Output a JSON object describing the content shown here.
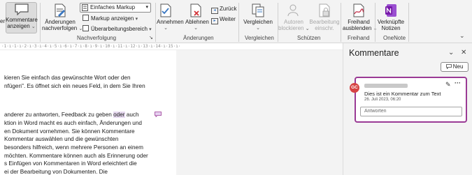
{
  "ribbon": {
    "cut_label_fragment": "er",
    "kommentare_anzeigen": {
      "line1": "Kommentare",
      "line2": "anzeigen"
    },
    "nachverfolgen": {
      "line1": "Änderungen",
      "line2": "nachverfolgen"
    },
    "markup_dropdown": "Einfaches Markup",
    "markup_anzeigen": "Markup anzeigen",
    "ueberarbeitungsbereich": "Überarbeitungsbereich",
    "group_nachverfolgung": "Nachverfolgung",
    "annehmen": "Annehmen",
    "ablehnen": "Ablehnen",
    "zurueck": "Zurück",
    "weiter": "Weiter",
    "group_aenderungen": "Änderungen",
    "vergleichen": "Vergleichen",
    "group_vergleichen": "Vergleichen",
    "autoren_blockieren": {
      "line1": "Autoren",
      "line2": "blockieren"
    },
    "bearbeitung_einschr": {
      "line1": "Bearbeitung",
      "line2": "einschr."
    },
    "group_schuetzen": "Schützen",
    "freihand_ausblenden": {
      "line1": "Freihand",
      "line2": "ausblenden"
    },
    "group_freihand": "Freihand",
    "verknuepfte_notizen": {
      "line1": "Verknüpfte",
      "line2": "Notizen"
    },
    "group_onenote": "OneNote",
    "chevron": "⌄",
    "launcher": "↘"
  },
  "ruler": {
    "text": "·1·ı·1·ı·2·ı·3·ı·4·ı·5·ı·6·ı·7·ı·8·ı·9·ı·10·ı·11·ı·12·ı·13·ı·14·ı·15·ı·"
  },
  "document": {
    "lines": [
      "kieren Sie einfach das gewünschte Wort oder den",
      "nfügen\". Es öffnet sich ein neues Feld, in dem Sie Ihren",
      "anderer zu antworten, Feedback zu geben ",
      "ktion in Word macht es auch einfach, Änderungen und",
      "en Dokument vornehmen. Sie können Kommentare",
      "Kommentar auswählen und die gewünschten",
      "besonders hilfreich, wenn mehrere Personen an einem",
      "möchten. Kommentare können auch als Erinnerung oder",
      "s Einfügen von Kommentaren in Word erleichtert die",
      "ei der Bearbeitung von Dokumenten. Die"
    ],
    "highlight_word": "oder",
    "line3_tail": " auch"
  },
  "comments_pane": {
    "title": "Kommentare",
    "collapse_icon": "⌄",
    "close_icon": "✕",
    "new_button": "Neu",
    "comment": {
      "avatar_initials": "GC",
      "text": "Dies ist ein Kommentar zum Text",
      "date": "26. Juli 2023, 06:20",
      "reply_placeholder": "Antworten"
    }
  },
  "colors": {
    "accent": "#9a3a95",
    "avatar": "#d64343",
    "highlight": "#e6d9ef",
    "onenote": "#7719aa"
  }
}
